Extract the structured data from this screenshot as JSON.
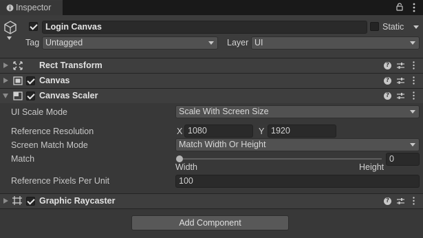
{
  "window": {
    "tab_label": "Inspector"
  },
  "header": {
    "object_name": "Login Canvas",
    "active": true,
    "static_label": "Static",
    "static_checked": false,
    "tag_label": "Tag",
    "tag_value": "Untagged",
    "layer_label": "Layer",
    "layer_value": "UI"
  },
  "components": [
    {
      "title": "Rect Transform",
      "has_checkbox": false,
      "expanded": false
    },
    {
      "title": "Canvas",
      "has_checkbox": true,
      "enabled": true,
      "expanded": false
    },
    {
      "title": "Canvas Scaler",
      "has_checkbox": true,
      "enabled": true,
      "expanded": true
    },
    {
      "title": "Graphic Raycaster",
      "has_checkbox": true,
      "enabled": true,
      "expanded": false
    }
  ],
  "canvas_scaler": {
    "ui_scale_mode_label": "UI Scale Mode",
    "ui_scale_mode_value": "Scale With Screen Size",
    "reference_resolution_label": "Reference Resolution",
    "res_x_label": "X",
    "res_x_value": "1080",
    "res_y_label": "Y",
    "res_y_value": "1920",
    "screen_match_mode_label": "Screen Match Mode",
    "screen_match_mode_value": "Match Width Or Height",
    "match_label": "Match",
    "match_value": "0",
    "match_min_label": "Width",
    "match_max_label": "Height",
    "ref_pixels_label": "Reference Pixels Per Unit",
    "ref_pixels_value": "100"
  },
  "add_component_label": "Add Component",
  "icons": {
    "tab": "inspector-icon",
    "lock": "lock-icon",
    "menu": "kebab-menu-icon",
    "gameobject": "cube-icon",
    "help": "help-icon",
    "presets": "presets-icon"
  },
  "colors": {
    "background": "#383838",
    "header_background": "#3e3e3e",
    "field_background": "#2a2a2a",
    "dropdown_background": "#515151",
    "button_background": "#585858"
  }
}
